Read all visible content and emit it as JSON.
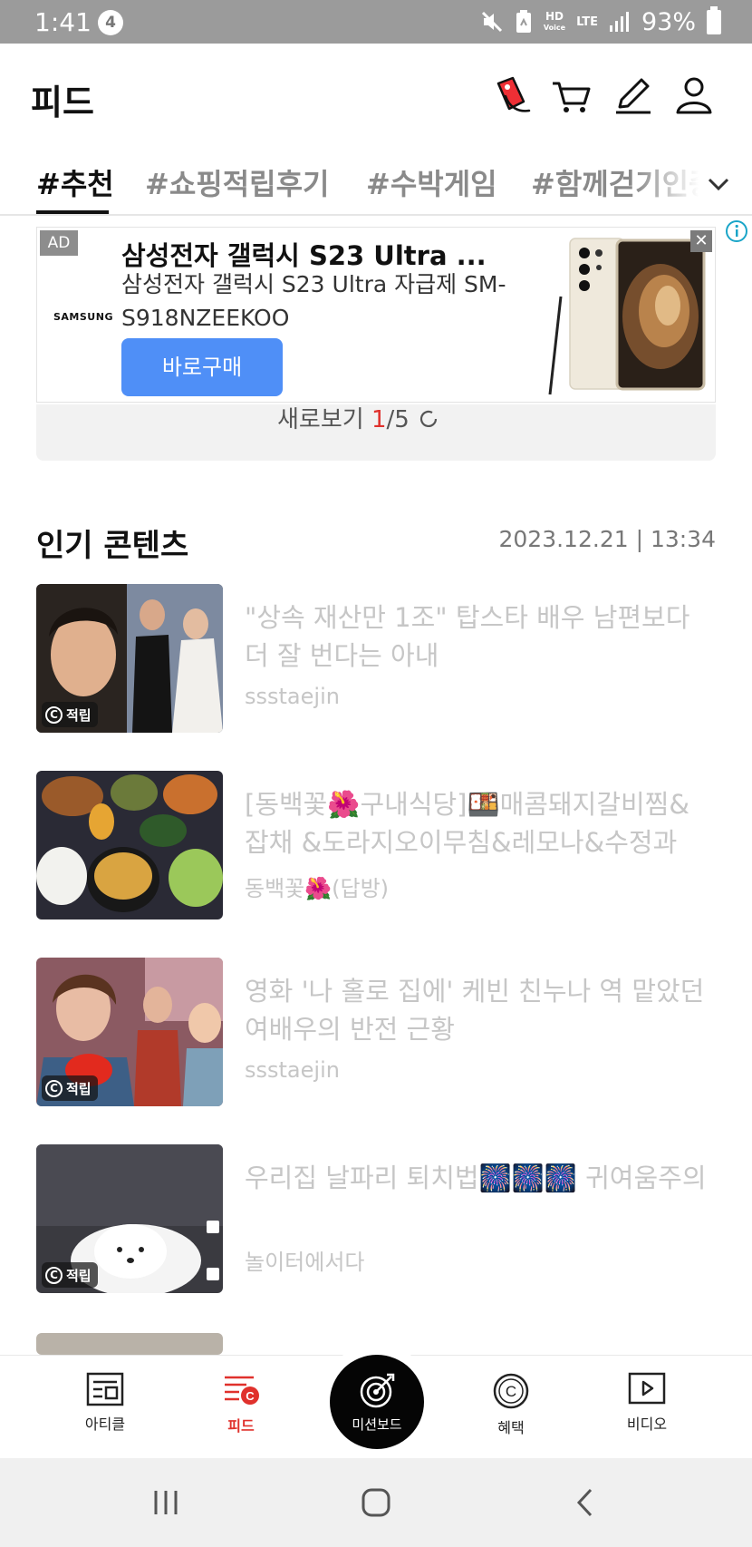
{
  "status_bar": {
    "time": "1:41",
    "notification_count": "4",
    "hd_label": "HD",
    "voice_label": "Voice",
    "network": "LTE",
    "battery": "93%"
  },
  "header": {
    "title": "피드"
  },
  "tabs": [
    {
      "label": "#추천"
    },
    {
      "label": "#쇼핑적립후기"
    },
    {
      "label": "#수박게임"
    },
    {
      "label": "#함께걷기인증"
    }
  ],
  "ad": {
    "badge": "AD",
    "brand": "SAMSUNG",
    "title": "삼성전자 갤럭시 S23 Ultra ...",
    "description": "삼성전자 갤럭시 S23 Ultra 자급제 SM-S918NZEEKOO",
    "button": "바로구매",
    "close": "✕"
  },
  "refresh": {
    "label": "새로보기",
    "current": "1",
    "total": "/5"
  },
  "popular": {
    "title": "인기 콘텐츠",
    "date": "2023.12.21 | 13:34",
    "items": [
      {
        "title": "\"상속 재산만 1조\" 탑스타 배우 남편보다 더 잘 번다는 아내",
        "author": "ssstaejin",
        "badge": "적립"
      },
      {
        "title": "[동백꽃🌺구내식당]🍱매콤돼지갈비찜&잡채 &도라지오이무침&레모나&수정과",
        "author": "동백꽃🌺(답방)",
        "badge": ""
      },
      {
        "title": "영화 '나 홀로 집에' 케빈 친누나 역 맡았던 여배우의 반전 근황",
        "author": "ssstaejin",
        "badge": "적립"
      },
      {
        "title": "우리집 날파리 퇴치법🎆🎆🎆 귀여움주의",
        "author": "놀이터에서다",
        "badge": "적립"
      }
    ]
  },
  "bottom_nav": {
    "items": [
      {
        "label": "아티클"
      },
      {
        "label": "피드"
      },
      {
        "label": "혜택"
      },
      {
        "label": "비디오"
      }
    ],
    "fab_label": "미션보드"
  },
  "colors": {
    "accent": "#e0312c",
    "ad_button": "#4f8ff7"
  }
}
